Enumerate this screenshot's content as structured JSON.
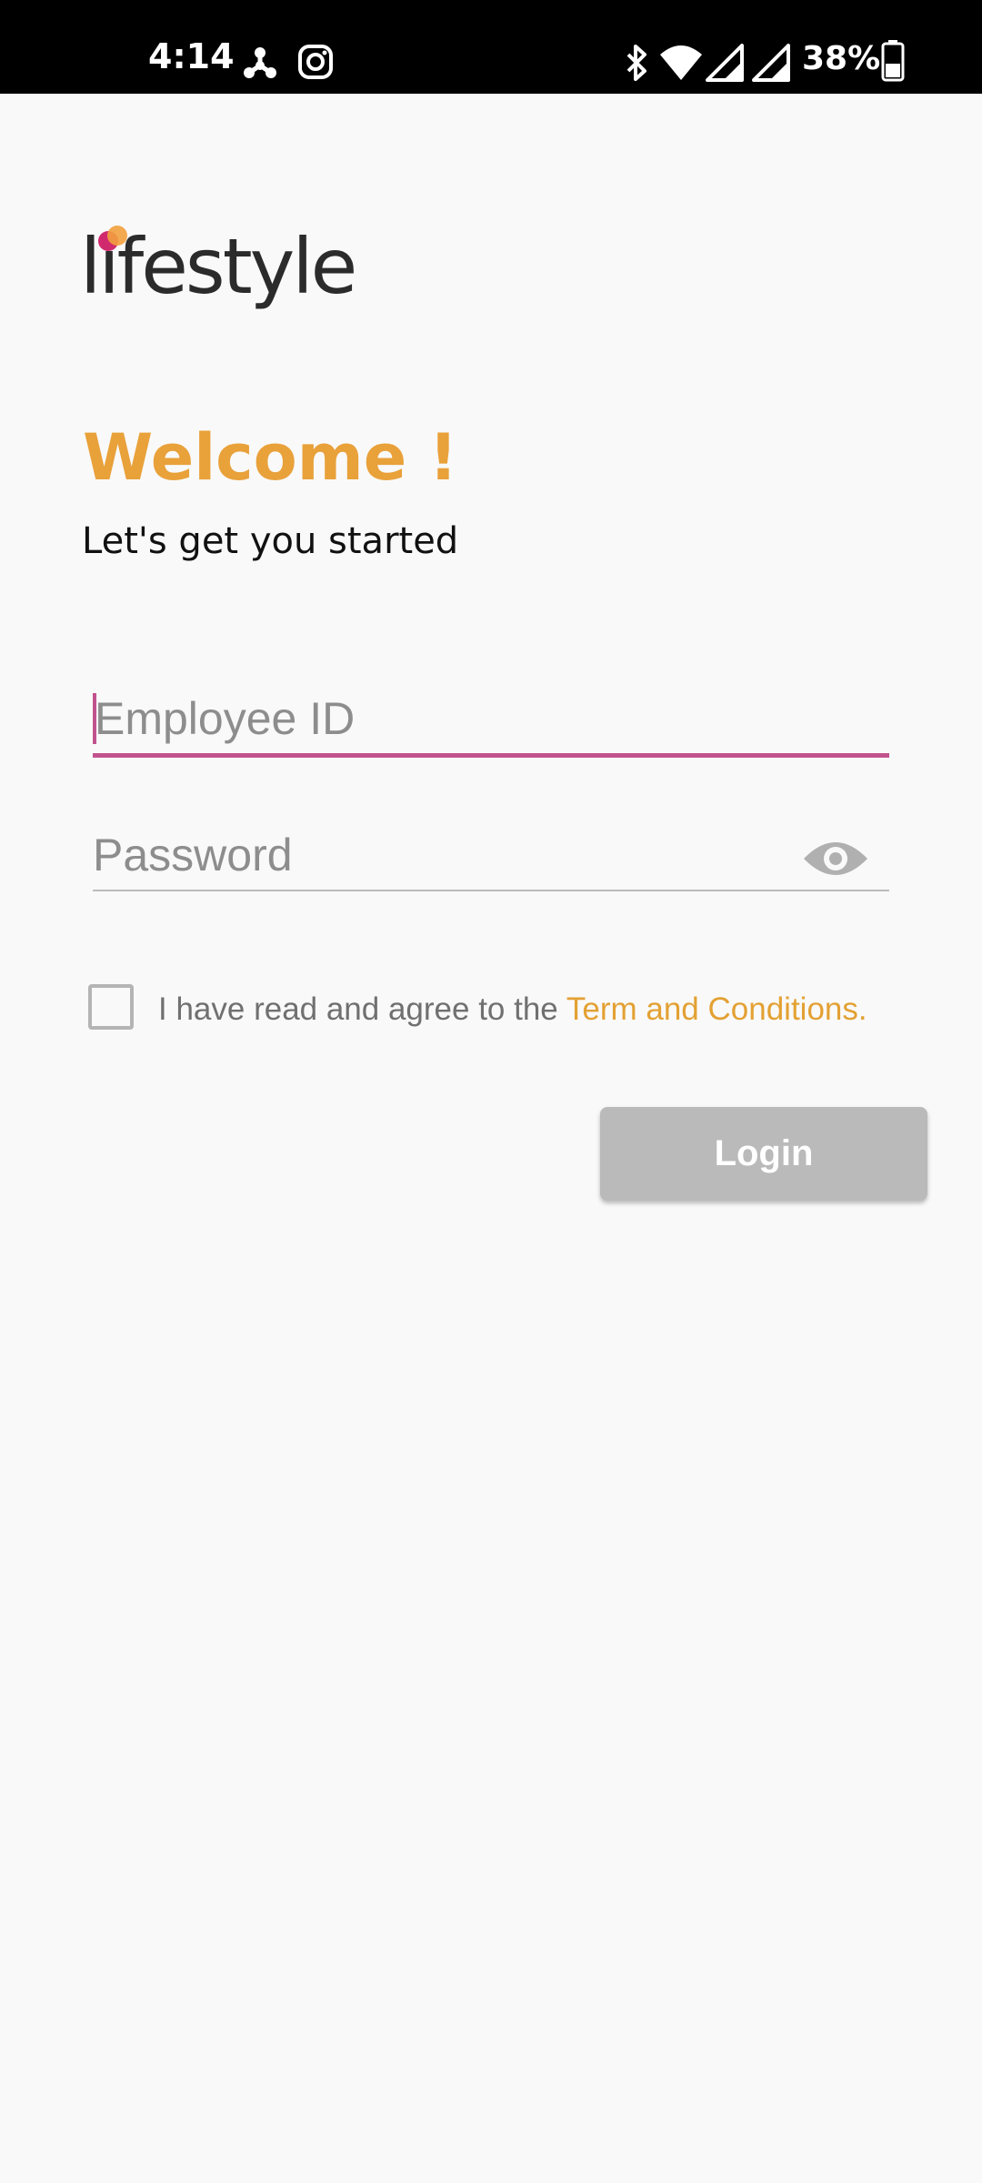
{
  "status_bar": {
    "time": "4:14",
    "battery_percent": "38%",
    "icons": [
      "fan-icon",
      "instagram-icon",
      "bluetooth-icon",
      "wifi-icon",
      "signal-icon",
      "signal-icon",
      "battery-icon"
    ]
  },
  "brand": {
    "logo_text": "lifestyle",
    "accent": "#e9a13a",
    "focus_color": "#c2528e"
  },
  "header": {
    "welcome": "Welcome !",
    "subtitle": "Let's get you started"
  },
  "form": {
    "employee_id": {
      "placeholder": "Employee ID",
      "value": ""
    },
    "password": {
      "placeholder": "Password",
      "value": ""
    },
    "agree_text": "I have read and agree to the ",
    "terms_link": "Term and Conditions.",
    "agree_checked": false,
    "login_label": "Login"
  }
}
